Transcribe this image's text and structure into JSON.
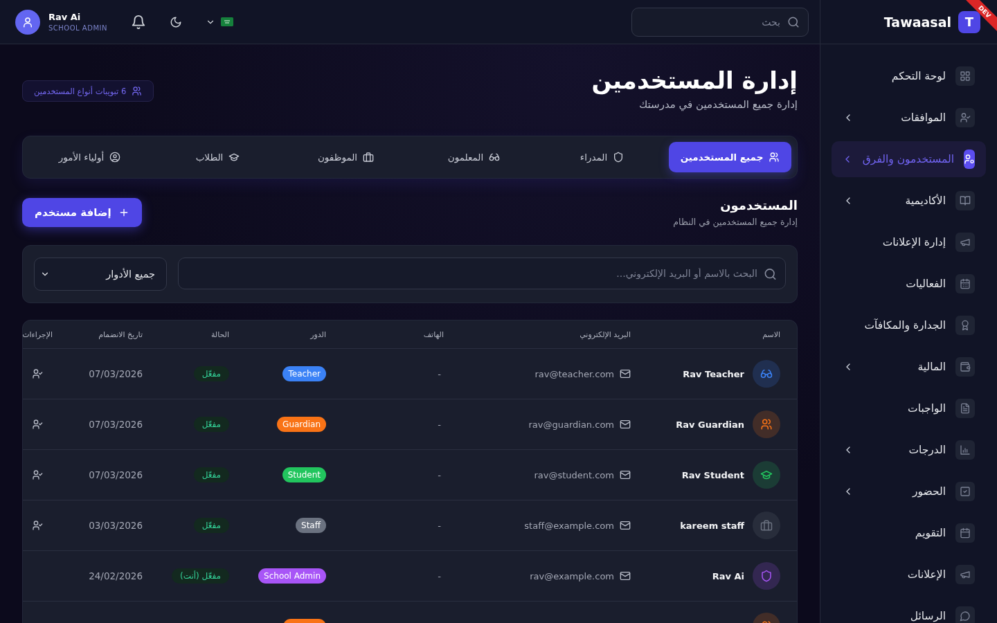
{
  "sidebar": {
    "brand": "Tawaasal",
    "logo_letter": "T",
    "dev_badge": "DEV",
    "items": [
      {
        "kind": "dashboard",
        "label": "لوحة التحكم",
        "expandable": false,
        "selected": false
      },
      {
        "kind": "approvals",
        "label": "الموافقات",
        "expandable": true,
        "selected": false
      },
      {
        "kind": "users",
        "label": "المستخدمون والفرق",
        "expandable": true,
        "selected": true
      },
      {
        "kind": "academics",
        "label": "الأكاديمية",
        "expandable": true,
        "selected": false
      },
      {
        "kind": "announcements",
        "label": "إدارة الإعلانات",
        "expandable": false,
        "selected": false
      },
      {
        "kind": "events",
        "label": "الفعاليات",
        "expandable": false,
        "selected": false
      },
      {
        "kind": "awards",
        "label": "الجدارة والمكافآت",
        "expandable": false,
        "selected": false
      },
      {
        "kind": "finance",
        "label": "المالية",
        "expandable": true,
        "selected": false
      },
      {
        "kind": "homework",
        "label": "الواجبات",
        "expandable": false,
        "selected": false
      },
      {
        "kind": "grades",
        "label": "الدرجات",
        "expandable": true,
        "selected": false
      },
      {
        "kind": "attendance",
        "label": "الحضور",
        "expandable": true,
        "selected": false
      },
      {
        "kind": "calendar",
        "label": "التقويم",
        "expandable": false,
        "selected": false
      },
      {
        "kind": "announcements",
        "label": "الإعلانات",
        "expandable": false,
        "selected": false
      },
      {
        "kind": "messages",
        "label": "الرسائل",
        "expandable": false,
        "selected": false
      }
    ]
  },
  "top_bar": {
    "search": {
      "placeholder": "بحث"
    },
    "user": {
      "name": "Rav Ai",
      "role": "SCHOOL ADMIN"
    }
  },
  "page": {
    "title": "إدارة المستخدمين",
    "subtitle": "إدارة جميع المستخدمين في مدرستك",
    "tabs_badge": "6 تبويبات أنواع المستخدمين",
    "tabs": [
      {
        "kind": "all",
        "label": "جميع المستخدمين",
        "selected": true
      },
      {
        "kind": "admin",
        "label": "المدراء",
        "selected": false
      },
      {
        "kind": "teacher",
        "label": "المعلمون",
        "selected": false
      },
      {
        "kind": "staff",
        "label": "الموظفون",
        "selected": false
      },
      {
        "kind": "student",
        "label": "الطلاب",
        "selected": false
      },
      {
        "kind": "guardian",
        "label": "أولياء الأمور",
        "selected": false
      }
    ],
    "section_title": "المستخدمون",
    "section_subtitle": "إدارة جميع المستخدمين في النظام",
    "add_button": "إضافة مستخدم",
    "filter": {
      "search": {
        "placeholder": "البحث بالاسم أو البريد الإلكتروني..."
      },
      "role_select": {
        "value": "جميع الأدوار"
      }
    },
    "table": {
      "columns": [
        "الاسم",
        "البريد الإلكتروني",
        "الهاتف",
        "الدور",
        "الحالة",
        "تاريخ الانضمام",
        "الإجراءات"
      ],
      "rows": [
        {
          "kind": "teacher",
          "color": "#3b82f6",
          "name": "Rav Teacher",
          "email": "rav@teacher.com",
          "phone": "-",
          "role": "Teacher",
          "status": "مفعّل",
          "joined": "07/03/2026",
          "action": true
        },
        {
          "kind": "guardian",
          "color": "#f97316",
          "name": "Rav Guardian",
          "email": "rav@guardian.com",
          "phone": "-",
          "role": "Guardian",
          "status": "مفعّل",
          "joined": "07/03/2026",
          "action": true
        },
        {
          "kind": "student",
          "color": "#22c55e",
          "name": "Rav Student",
          "email": "rav@student.com",
          "phone": "-",
          "role": "Student",
          "status": "مفعّل",
          "joined": "07/03/2026",
          "action": true
        },
        {
          "kind": "staff",
          "color": "#6b7280",
          "name": "kareem staff",
          "email": "staff@example.com",
          "phone": "-",
          "role": "Staff",
          "status": "مفعّل",
          "joined": "03/03/2026",
          "action": true
        },
        {
          "kind": "admin",
          "color": "#a855f7",
          "name": "Rav Ai",
          "email": "rav@example.com",
          "phone": "-",
          "role": "School Admin",
          "status": "مفعّل (أنت)",
          "joined": "24/02/2026",
          "action": false
        },
        {
          "kind": "guardian",
          "color": "#f97316",
          "action": false
        }
      ]
    }
  }
}
